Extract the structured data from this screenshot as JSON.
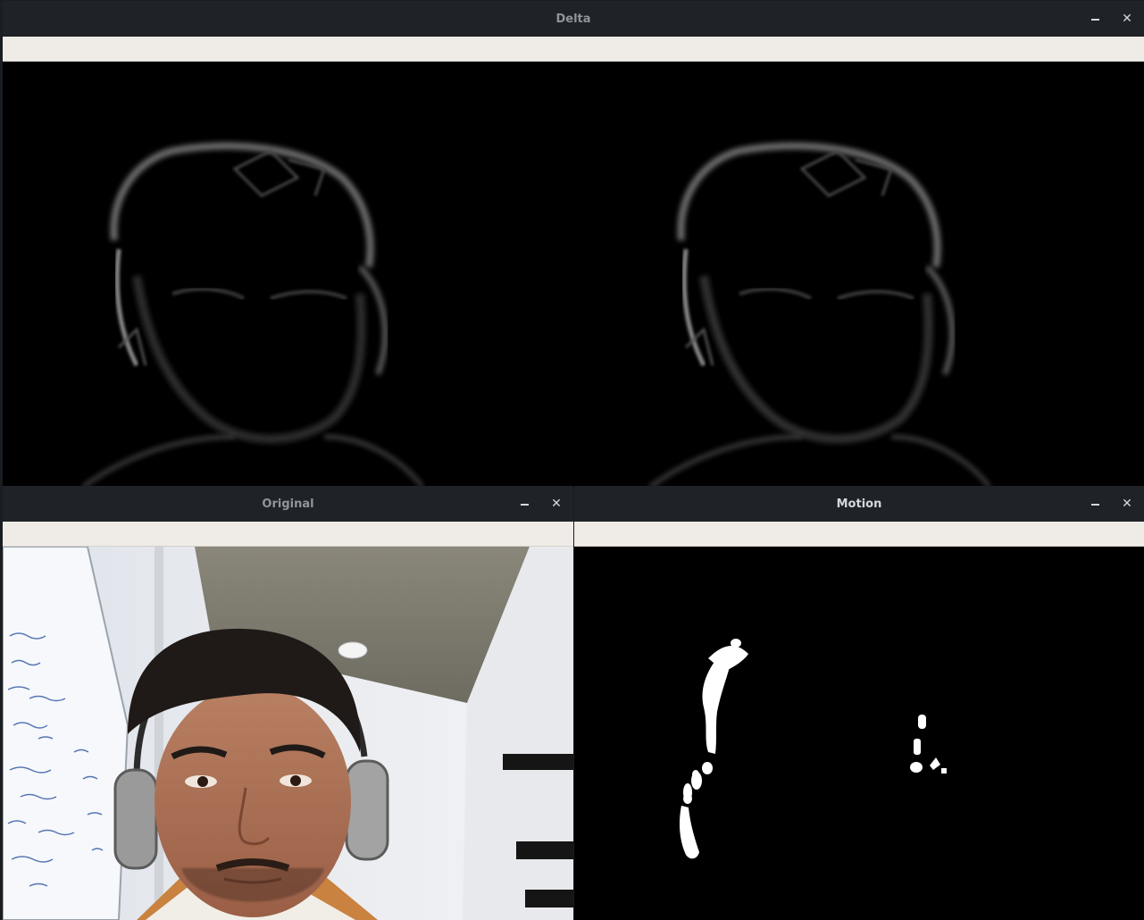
{
  "windows": {
    "delta": {
      "title": "Delta"
    },
    "original": {
      "title": "Original"
    },
    "motion": {
      "title": "Motion"
    }
  },
  "icons": {
    "minimize": "minimize-icon",
    "close": "close-icon"
  },
  "controls": {
    "minimize_glyph": "",
    "close_glyph": "✕"
  },
  "colors": {
    "titlebar": "#1f2226",
    "toolbar": "#efebe7",
    "canvas": "#000000",
    "motion_blob": "#ffffff"
  }
}
